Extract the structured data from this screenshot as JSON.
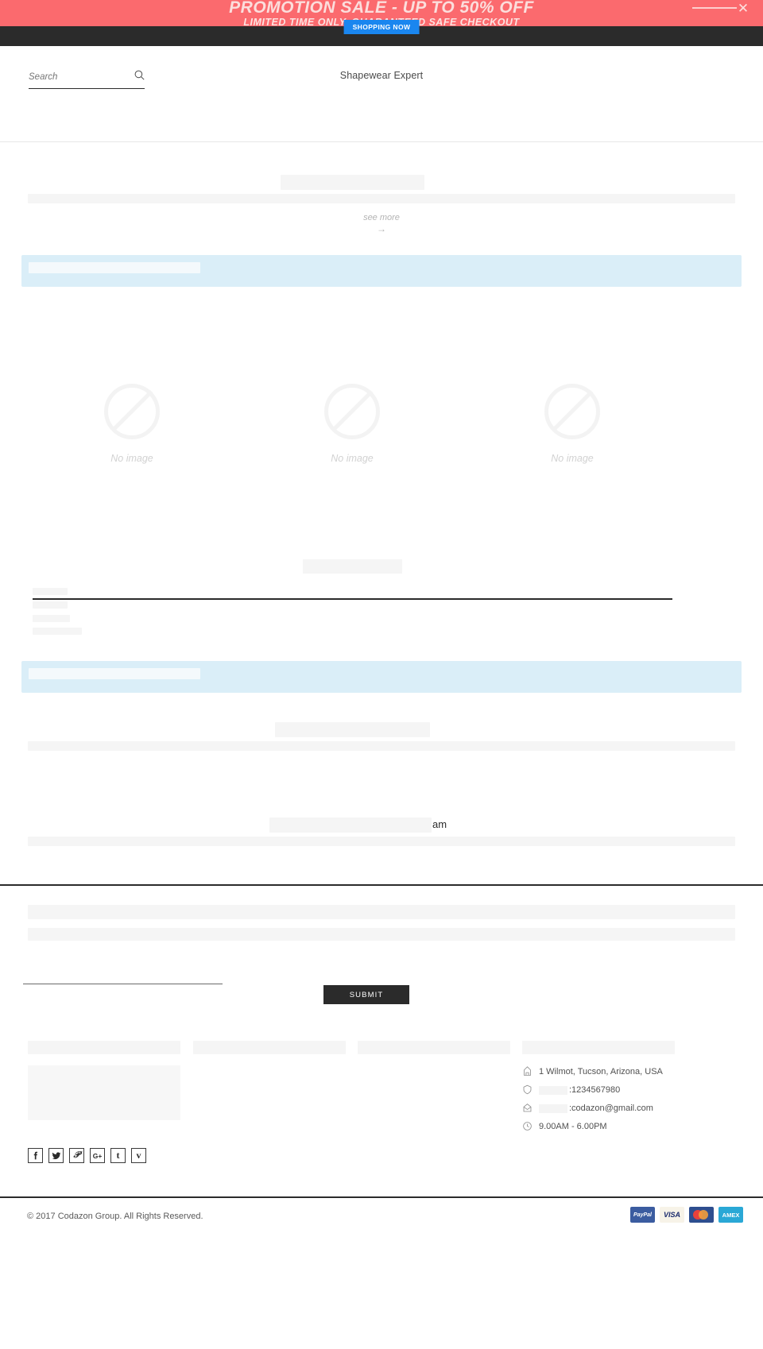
{
  "promo": {
    "line1": "PROMOTION SALE - UP TO 50% OFF",
    "line2": "LIMITED TIME ONLY, GUARANTEED SAFE CHECKOUT",
    "cta_label": "SHOPPING NOW",
    "close_icon": "close-icon",
    "bg_color": "#fb6a6e",
    "cta_color": "#1a86ef"
  },
  "header": {
    "search_placeholder": "Search",
    "search_value": "",
    "search_icon": "search-icon",
    "brand_title": "Shapewear Expert"
  },
  "main": {
    "see_more_label": "see more",
    "see_more_arrow": "→",
    "no_image_label": "No image",
    "stray_text": "am"
  },
  "form": {
    "submit_label": "SUBMIT"
  },
  "footer": {
    "contacts": [
      {
        "icon": "map-marker-icon",
        "masked": false,
        "text": "1 Wilmot, Tucson, Arizona, USA"
      },
      {
        "icon": "phone-icon",
        "masked": true,
        "text": ":1234567980"
      },
      {
        "icon": "envelope-icon",
        "masked": true,
        "text": ":codazon@gmail.com"
      },
      {
        "icon": "clock-icon",
        "masked": false,
        "text": "9.00AM - 6.00PM"
      }
    ],
    "social": [
      {
        "name": "facebook-icon",
        "glyph": "f"
      },
      {
        "name": "twitter-icon",
        "glyph": "🐦"
      },
      {
        "name": "pinterest-icon",
        "glyph": "ℙ"
      },
      {
        "name": "googleplus-icon",
        "glyph": "G+"
      },
      {
        "name": "tumblr-icon",
        "glyph": "t"
      },
      {
        "name": "vimeo-icon",
        "glyph": "v"
      }
    ],
    "copyright": "© 2017 Codazon Group. All Rights Reserved.",
    "payments": [
      {
        "name": "paypal-logo",
        "label": "PayPal"
      },
      {
        "name": "visa-logo",
        "label": "VISA"
      },
      {
        "name": "mastercard-logo",
        "label": ""
      },
      {
        "name": "amex-logo",
        "label": "AMEX"
      }
    ]
  }
}
